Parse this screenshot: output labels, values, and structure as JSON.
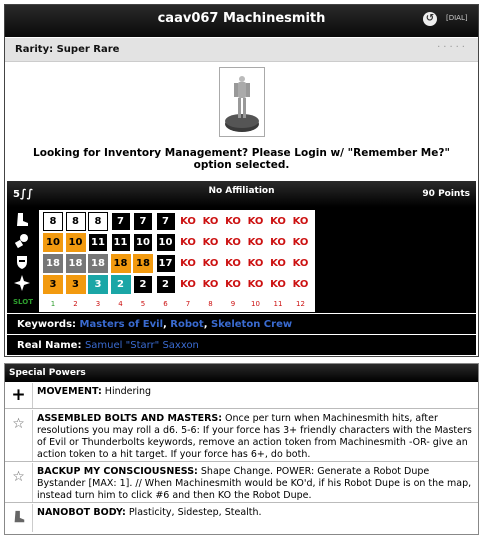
{
  "card": {
    "title": "caav067 Machinesmith",
    "dial_link": "[DIAL]",
    "rarity": "Rarity: Super Rare",
    "rarity_dots": "·····",
    "inventory_message": "Looking for Inventory Management? Please Login w/ \"Remember Me?\" option selected.",
    "speed_label": "5",
    "affiliation": "No Affiliation",
    "points": "90 Points"
  },
  "dial": {
    "slot_label": "SLOT",
    "slot_numbers": [
      "1",
      "2",
      "3",
      "4",
      "5",
      "6",
      "7",
      "8",
      "9",
      "10",
      "11",
      "12"
    ],
    "rows": [
      {
        "stat": "speed",
        "icon": "boot-icon",
        "values": [
          "8",
          "8",
          "8",
          "7",
          "7",
          "7",
          "KO",
          "KO",
          "KO",
          "KO",
          "KO",
          "KO"
        ]
      },
      {
        "stat": "attack",
        "icon": "fist-icon",
        "values": [
          "10",
          "10",
          "11",
          "11",
          "10",
          "10",
          "KO",
          "KO",
          "KO",
          "KO",
          "KO",
          "KO"
        ]
      },
      {
        "stat": "defense",
        "icon": "shield-icon",
        "values": [
          "18",
          "18",
          "18",
          "18",
          "18",
          "17",
          "KO",
          "KO",
          "KO",
          "KO",
          "KO",
          "KO"
        ]
      },
      {
        "stat": "damage",
        "icon": "starburst-icon",
        "values": [
          "3",
          "3",
          "3",
          "2",
          "2",
          "2",
          "KO",
          "KO",
          "KO",
          "KO",
          "KO",
          "KO"
        ]
      }
    ],
    "colors": [
      [
        "white",
        "white",
        "white",
        "black",
        "black",
        "black",
        "ko",
        "ko",
        "ko",
        "ko",
        "ko",
        "ko"
      ],
      [
        "orange",
        "orange",
        "black",
        "black",
        "black",
        "black",
        "ko",
        "ko",
        "ko",
        "ko",
        "ko",
        "ko"
      ],
      [
        "gray",
        "gray",
        "gray",
        "orange",
        "orange",
        "black",
        "ko",
        "ko",
        "ko",
        "ko",
        "ko",
        "ko"
      ],
      [
        "orange",
        "orange",
        "teal",
        "teal",
        "black",
        "black",
        "ko",
        "ko",
        "ko",
        "ko",
        "ko",
        "ko"
      ]
    ]
  },
  "keywords": {
    "label": "Keywords:",
    "items": [
      "Masters of Evil",
      "Robot",
      "Skeleton Crew"
    ]
  },
  "real_name": {
    "label": "Real Name:",
    "value": "Samuel \"Starr\" Saxxon"
  },
  "special_powers": {
    "header": "Special Powers",
    "powers": [
      {
        "icon": "plus-icon",
        "name": "MOVEMENT:",
        "text": " Hindering"
      },
      {
        "icon": "star-icon",
        "name": "ASSEMBLED BOLTS AND MASTERS:",
        "text": " Once per turn when Machinesmith hits, after resolutions you may roll a d6. 5-6: If your force has 3+ friendly characters with the Masters of Evil or Thunderbolts keywords, remove an action token from Machinesmith -OR- give an action token to a hit target. If your force has 6+, do both."
      },
      {
        "icon": "star-icon",
        "name": "BACKUP MY CONSCIOUSNESS:",
        "text": " Shape Change. POWER: Generate a Robot Dupe Bystander [MAX: 1]. // When Machinesmith would be KO'd, if his Robot Dupe is on the map, instead turn him to click #6 and then KO the Robot Dupe."
      },
      {
        "icon": "boot-icon",
        "name": "NANOBOT BODY:",
        "text": " Plasticity, Sidestep, Stealth."
      }
    ]
  },
  "palette": {
    "white": "#ffffff",
    "black": "#000000",
    "orange": "#f29a0f",
    "gray": "#777777",
    "teal": "#1aa6a6",
    "ko": "#ffffff",
    "ko_text": "#cc1111",
    "keyword_link": "#3a6bd1"
  }
}
